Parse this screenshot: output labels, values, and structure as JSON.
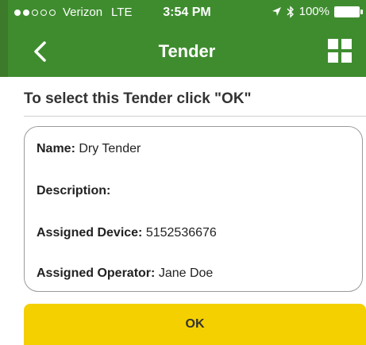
{
  "status_bar": {
    "carrier": "Verizon",
    "network": "LTE",
    "time": "3:54 PM",
    "battery": "100%",
    "signal_bars_filled": 2,
    "signal_bars_total": 5
  },
  "nav": {
    "title": "Tender",
    "back_icon": "chevron-left-icon",
    "grid_icon": "grid-icon"
  },
  "instruction": "To select this Tender click \"OK\"",
  "details": {
    "name_label": "Name:",
    "name_value": "Dry Tender",
    "description_label": "Description:",
    "description_value": "",
    "device_label": "Assigned Device:",
    "device_value": "5152536676",
    "operator_label": "Assigned Operator:",
    "operator_value": "Jane Doe"
  },
  "ok_button": "OK",
  "colors": {
    "header_green": "#3f8c2f",
    "button_yellow": "#f4d000"
  }
}
